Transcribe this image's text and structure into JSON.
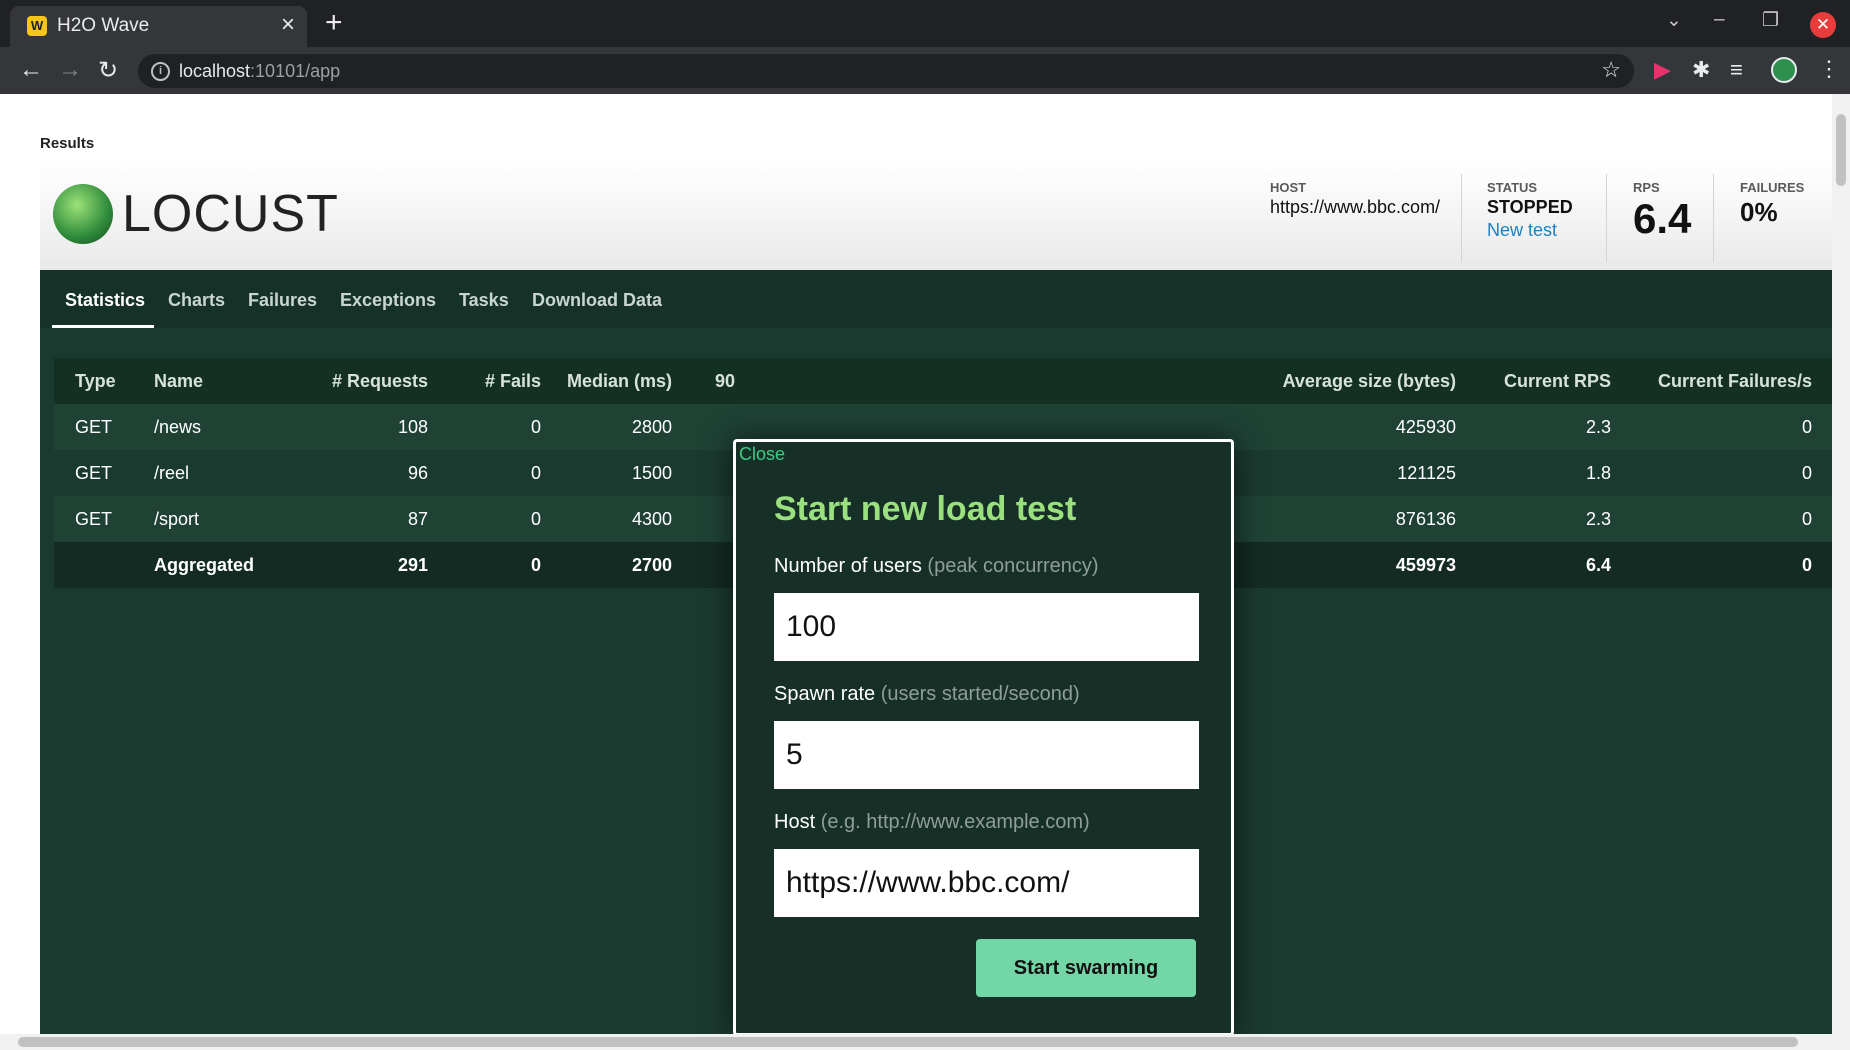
{
  "browser": {
    "tab_title": "H2O Wave",
    "favicon": "wave-logo-icon",
    "url_host": "localhost",
    "url_path": ":10101/app"
  },
  "page": {
    "results_label": "Results"
  },
  "locust": {
    "logo_text": "LOCUST",
    "host_label": "HOST",
    "host_value": "https://www.bbc.com/",
    "status_label": "STATUS",
    "status_value": "STOPPED",
    "new_test_link": "New test",
    "rps_label": "RPS",
    "rps_value": "6.4",
    "failures_label": "FAILURES",
    "failures_value": "0%"
  },
  "nav_tabs": [
    "Statistics",
    "Charts",
    "Failures",
    "Exceptions",
    "Tasks",
    "Download Data"
  ],
  "table": {
    "columns": {
      "type": "Type",
      "name": "Name",
      "requests": "# Requests",
      "fails": "# Fails",
      "median": "Median (ms)",
      "p90_partial": "90",
      "avg_size": "Average size (bytes)",
      "current_rps": "Current RPS",
      "current_failures": "Current Failures/s"
    },
    "rows": [
      {
        "type": "GET",
        "name": "/news",
        "requests": "108",
        "fails": "0",
        "median": "2800",
        "avg_size": "425930",
        "current_rps": "2.3",
        "current_failures": "0"
      },
      {
        "type": "GET",
        "name": "/reel",
        "requests": "96",
        "fails": "0",
        "median": "1500",
        "avg_size": "121125",
        "current_rps": "1.8",
        "current_failures": "0"
      },
      {
        "type": "GET",
        "name": "/sport",
        "requests": "87",
        "fails": "0",
        "median": "4300",
        "avg_size": "876136",
        "current_rps": "2.3",
        "current_failures": "0"
      }
    ],
    "aggregated": {
      "type": "",
      "name": "Aggregated",
      "requests": "291",
      "fails": "0",
      "median": "2700",
      "avg_size": "459973",
      "current_rps": "6.4",
      "current_failures": "0"
    }
  },
  "modal": {
    "close_label": "Close",
    "title": "Start new load test",
    "users_label": "Number of users",
    "users_hint": "(peak concurrency)",
    "users_value": "100",
    "spawn_label": "Spawn rate",
    "spawn_hint": "(users started/second)",
    "spawn_value": "5",
    "host_label": "Host",
    "host_hint": "(e.g. http://www.example.com)",
    "host_value": "https://www.bbc.com/",
    "start_button": "Start swarming"
  },
  "colors": {
    "accent_green": "#9be07f",
    "button_green": "#73d6a6",
    "link_blue": "#1a82c4",
    "panel_dark": "#1b3a2f"
  }
}
